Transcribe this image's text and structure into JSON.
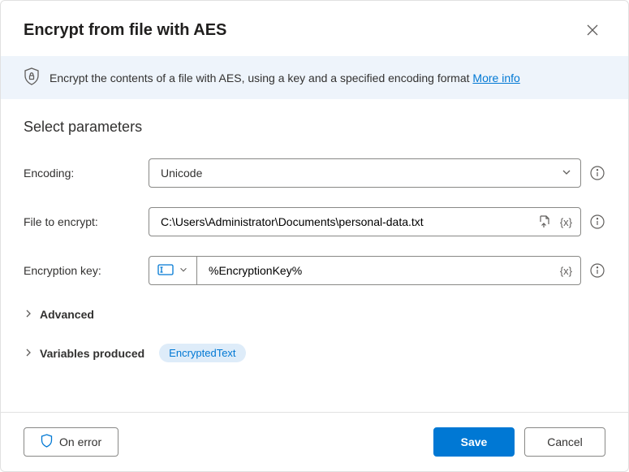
{
  "header": {
    "title": "Encrypt from file with AES"
  },
  "banner": {
    "text": "Encrypt the contents of a file with AES, using a key and a specified encoding format ",
    "link_label": "More info"
  },
  "section_title": "Select parameters",
  "fields": {
    "encoding": {
      "label": "Encoding:",
      "value": "Unicode"
    },
    "file": {
      "label": "File to encrypt:",
      "value": "C:\\Users\\Administrator\\Documents\\personal-data.txt"
    },
    "key": {
      "label": "Encryption key:",
      "value": "%EncryptionKey%"
    }
  },
  "expanders": {
    "advanced": "Advanced",
    "variables": "Variables produced",
    "variable_chip": "EncryptedText"
  },
  "footer": {
    "on_error": "On error",
    "save": "Save",
    "cancel": "Cancel"
  }
}
